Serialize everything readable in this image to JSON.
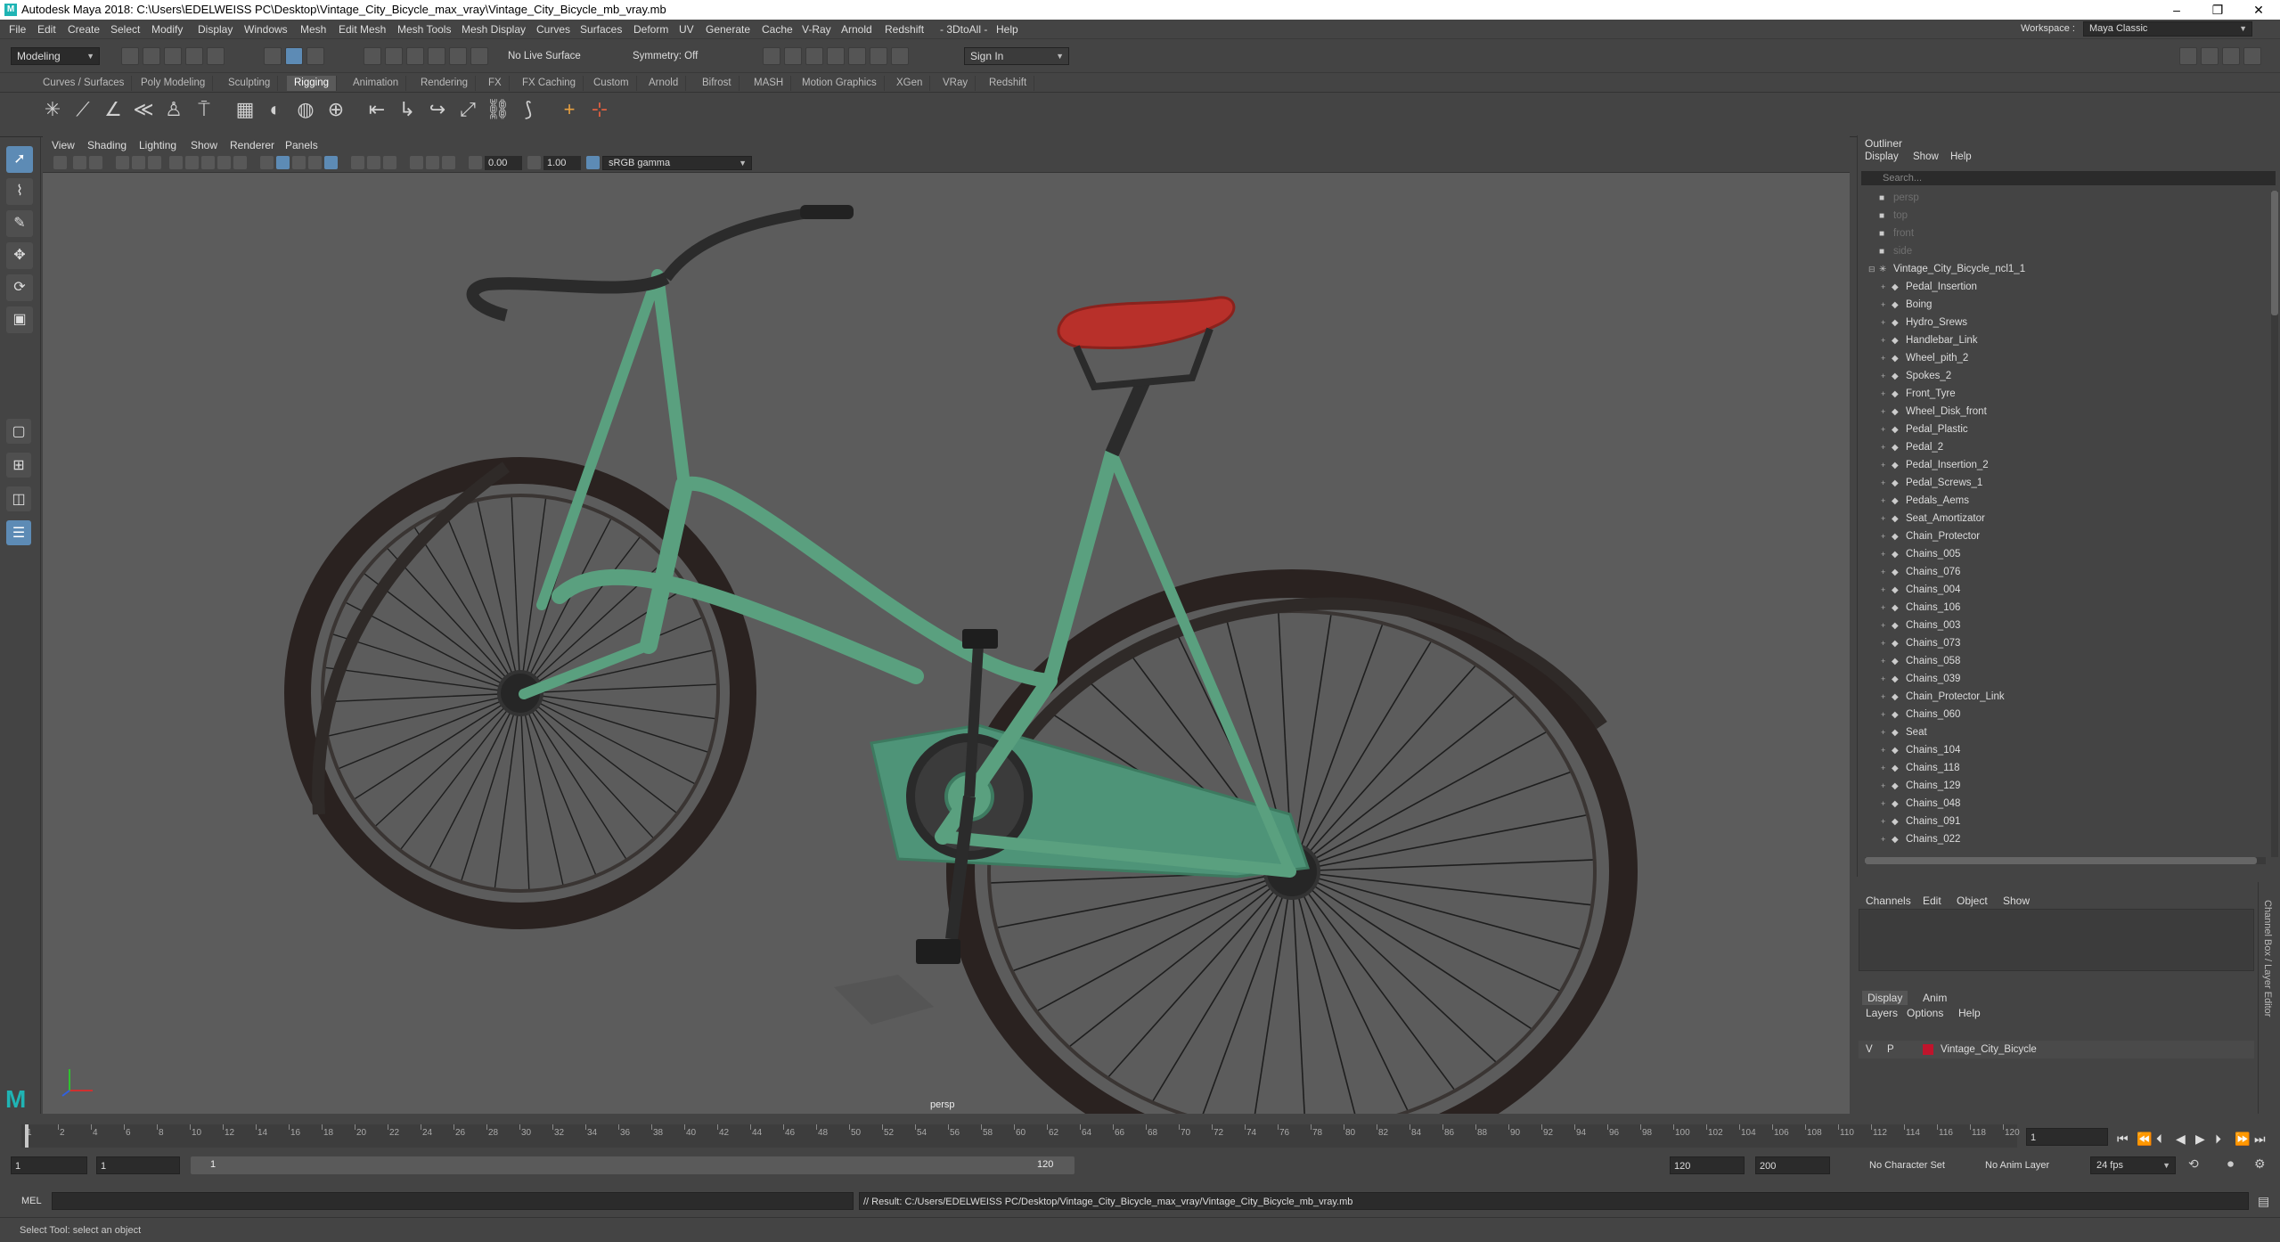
{
  "title_bar": {
    "title": "Autodesk Maya 2018: C:\\Users\\EDELWEISS PC\\Desktop\\Vintage_City_Bicycle_max_vray\\Vintage_City_Bicycle_mb_vray.mb",
    "minimize": "–",
    "maximize": "❐",
    "close": "✕"
  },
  "menu": [
    "File",
    "Edit",
    "Create",
    "Select",
    "Modify",
    "Display",
    "Windows",
    "Mesh",
    "Edit Mesh",
    "Mesh Tools",
    "Mesh Display",
    "Curves",
    "Surfaces",
    "Deform",
    "UV",
    "Generate",
    "Cache",
    "V-Ray",
    "Arnold",
    "Redshift",
    "- 3DtoAll -",
    "Help"
  ],
  "workspace": {
    "label": "Workspace :",
    "value": "Maya Classic"
  },
  "status_line": {
    "mode": "Modeling",
    "live_surface": "No Live Surface",
    "symmetry": "Symmetry: Off",
    "sign_in": "Sign In"
  },
  "shelf_tabs": [
    "Curves / Surfaces",
    "Poly Modeling",
    "Sculpting",
    "Rigging",
    "Animation",
    "Rendering",
    "FX",
    "FX Caching",
    "Custom",
    "Arnold",
    "Bifrost",
    "MASH",
    "Motion Graphics",
    "XGen",
    "VRay",
    "Redshift"
  ],
  "active_shelf": "Rigging",
  "panel_menu": [
    "View",
    "Shading",
    "Lighting",
    "Show",
    "Renderer",
    "Panels"
  ],
  "panel_toolbar": {
    "exposure": "0.00",
    "gamma": "1.00",
    "color_space": "sRGB gamma"
  },
  "viewport": {
    "camera_label": "persp",
    "background_color": "#5c5c5c"
  },
  "outliner": {
    "title": "Outliner",
    "menu": [
      "Display",
      "Show",
      "Help"
    ],
    "search_placeholder": "Search...",
    "cameras": [
      "persp",
      "top",
      "front",
      "side"
    ],
    "root": "Vintage_City_Bicycle_ncl1_1",
    "children": [
      "Pedal_Insertion",
      "Boing",
      "Hydro_Srews",
      "Handlebar_Link",
      "Wheel_pith_2",
      "Spokes_2",
      "Front_Tyre",
      "Wheel_Disk_front",
      "Pedal_Plastic",
      "Pedal_2",
      "Pedal_Insertion_2",
      "Pedal_Screws_1",
      "Pedals_Aems",
      "Seat_Amortizator",
      "Chain_Protector",
      "Chains_005",
      "Chains_076",
      "Chains_004",
      "Chains_106",
      "Chains_003",
      "Chains_073",
      "Chains_058",
      "Chains_039",
      "Chain_Protector_Link",
      "Chains_060",
      "Seat",
      "Chains_104",
      "Chains_118",
      "Chains_129",
      "Chains_048",
      "Chains_091",
      "Chains_022"
    ]
  },
  "channel_box": {
    "menu": [
      "Channels",
      "Edit",
      "Object",
      "Show"
    ],
    "side_label": "Channel Box / Layer Editor"
  },
  "layer_editor": {
    "tabs": [
      "Display",
      "Anim"
    ],
    "menu": [
      "Layers",
      "Options",
      "Help"
    ],
    "layer": {
      "v": "V",
      "p": "P",
      "color": "#c0142c",
      "name": "Vintage_City_Bicycle"
    }
  },
  "timeline": {
    "ticks": [
      "1",
      "2",
      "4",
      "6",
      "8",
      "10",
      "12",
      "14",
      "16",
      "18",
      "20",
      "22",
      "24",
      "26",
      "28",
      "30",
      "32",
      "34",
      "36",
      "38",
      "40",
      "42",
      "44",
      "46",
      "48",
      "50",
      "52",
      "54",
      "56",
      "58",
      "60",
      "62",
      "64",
      "66",
      "68",
      "70",
      "72",
      "74",
      "76",
      "78",
      "80",
      "82",
      "84",
      "86",
      "88",
      "90",
      "92",
      "94",
      "96",
      "98",
      "100",
      "102",
      "104",
      "106",
      "108",
      "110",
      "112",
      "114",
      "116",
      "118",
      "120"
    ],
    "current_frame": "1",
    "current_frame_position": 0.0
  },
  "range": {
    "start": "1",
    "anim_start": "1",
    "slider_start": "1",
    "slider_end": "120",
    "end": "120",
    "anim_end": "200",
    "character_set": "No Character Set",
    "anim_layer": "No Anim Layer",
    "fps": "24 fps"
  },
  "command_line": {
    "label": "MEL",
    "result": "// Result: C:/Users/EDELWEISS PC/Desktop/Vintage_City_Bicycle_max_vray/Vintage_City_Bicycle_mb_vray.mb"
  },
  "help_line": "Select Tool: select an object",
  "colors": {
    "frame": "#5aa07f",
    "tyre": "#2a2220",
    "seat": "#b8302a",
    "accent": "#5d8bb5"
  }
}
